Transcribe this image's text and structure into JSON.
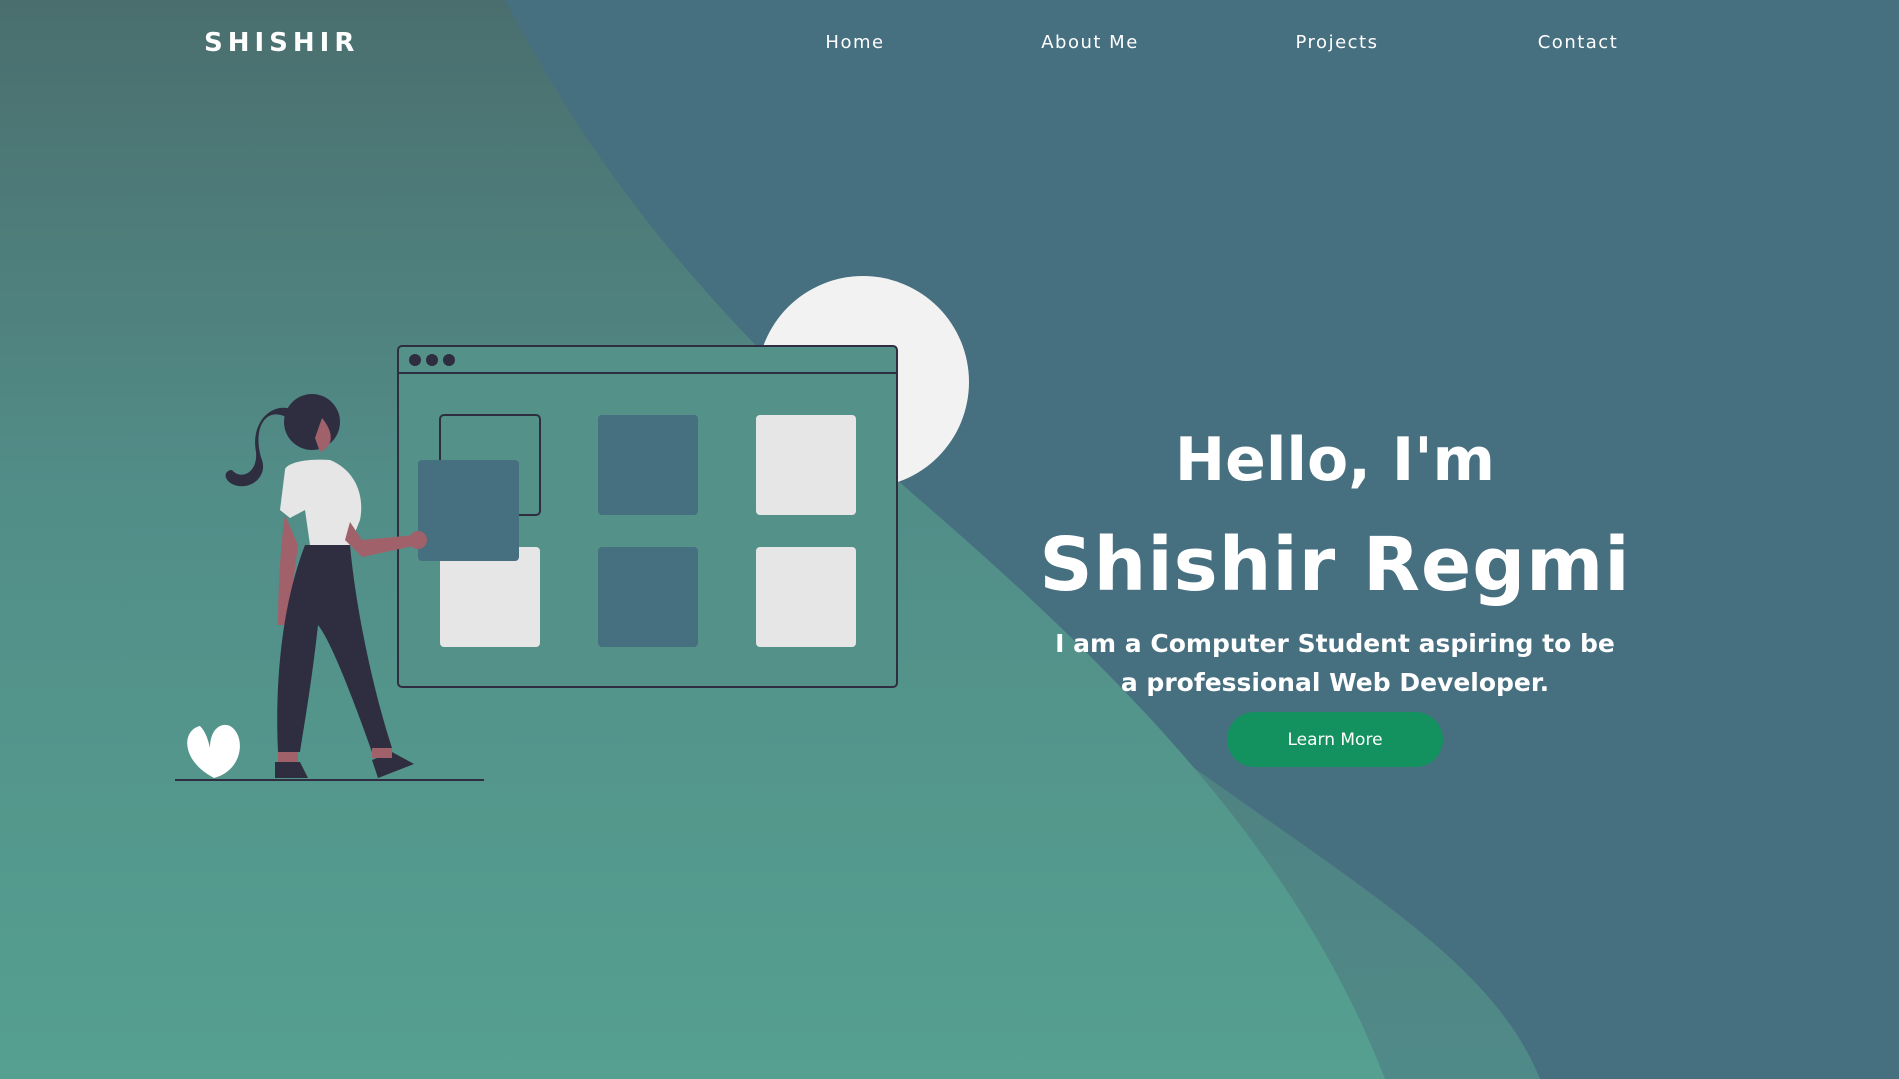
{
  "brand": {
    "logo_text": "SHISHIR"
  },
  "nav": {
    "items": [
      {
        "label": "Home"
      },
      {
        "label": "About Me"
      },
      {
        "label": "Projects"
      },
      {
        "label": "Contact"
      }
    ]
  },
  "hero": {
    "greeting": "Hello, I'm",
    "name": "Shishir Regmi",
    "tagline": "I am a Computer Student aspiring to be a professional Web Developer.",
    "cta_label": "Learn More"
  },
  "colors": {
    "background_primary": "#466f80",
    "background_wave": "#529a8e",
    "accent_button": "#13925f",
    "text": "#ffffff"
  },
  "icons": [
    "browser-window-illustration",
    "person-illustration",
    "plant-icon",
    "circle-decoration"
  ]
}
